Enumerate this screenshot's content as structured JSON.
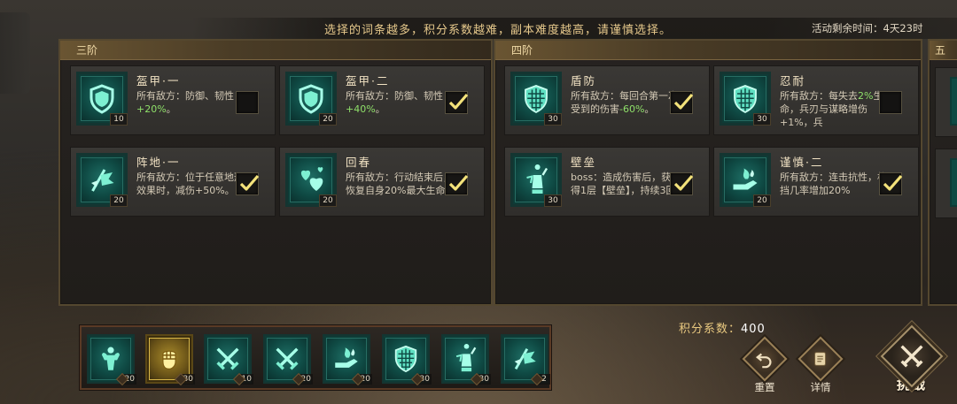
{
  "banner": {
    "message": "选择的词条越多，积分系数越难，副本难度越高，请谨慎选择。",
    "timer": "活动剩余时间：4天23时"
  },
  "tiers": [
    {
      "title": "三阶",
      "cards": [
        {
          "title": "盔甲·一",
          "desc_prefix": "所有敌方：防御、韧性",
          "desc_highlight": "+20%",
          "desc_suffix": "。",
          "level": "10",
          "checked": false,
          "icon": "shield-icon"
        },
        {
          "title": "盔甲·二",
          "desc_prefix": "所有敌方：防御、韧性",
          "desc_highlight": "+40%",
          "desc_suffix": "。",
          "level": "20",
          "checked": true,
          "icon": "shield-icon"
        },
        {
          "title": "阵地·一",
          "desc_prefix": "所有敌方：位于任意地形效果时，减伤+50%。",
          "desc_highlight": "",
          "desc_suffix": "",
          "level": "20",
          "checked": true,
          "icon": "flag-icon"
        },
        {
          "title": "回春",
          "desc_prefix": "所有敌方：行动结束后，恢复自身20%最大生命。",
          "desc_highlight": "",
          "desc_suffix": "",
          "level": "20",
          "checked": true,
          "icon": "hearts-icon"
        }
      ]
    },
    {
      "title": "四阶",
      "cards": [
        {
          "title": "盾防",
          "desc_prefix": "所有敌方：每回合第一次受到的伤害",
          "desc_highlight": "-60%",
          "desc_suffix": "。",
          "level": "30",
          "checked": true,
          "icon": "scale-shield-icon"
        },
        {
          "title": "忍耐",
          "desc_prefix": "所有敌方：每失去",
          "desc_highlight": "2%",
          "desc_suffix": "生命，兵刃与谋略增伤+1%，兵",
          "level": "30",
          "checked": false,
          "icon": "scale-shield-icon"
        },
        {
          "title": "壁垒",
          "desc_prefix": "boss：造成伤害后，获得1层【壁垒】，持续3回",
          "desc_highlight": "",
          "desc_suffix": "",
          "level": "30",
          "checked": true,
          "icon": "statue-icon"
        },
        {
          "title": "谨慎·二",
          "desc_prefix": "所有敌方：连击抗性，格挡几率增加20%",
          "desc_highlight": "",
          "desc_suffix": "",
          "level": "20",
          "checked": true,
          "icon": "hand-fire-icon"
        }
      ]
    },
    {
      "title": "五",
      "cards": []
    }
  ],
  "score": {
    "label": "积分系数：",
    "value": "400"
  },
  "selected": [
    {
      "icon": "strongman-icon",
      "level": "20"
    },
    {
      "icon": "fist-icon",
      "level": "30",
      "gold": true
    },
    {
      "icon": "crossed-swords-icon",
      "level": "10"
    },
    {
      "icon": "crossed-swords-icon",
      "level": "20"
    },
    {
      "icon": "hand-fire-icon",
      "level": "20"
    },
    {
      "icon": "scale-shield-icon",
      "level": "30"
    },
    {
      "icon": "statue-icon",
      "level": "30"
    },
    {
      "icon": "flag-icon",
      "level": "2"
    }
  ],
  "buttons": {
    "reset": "重置",
    "details": "详情",
    "challenge": "挑战"
  },
  "colors": {
    "accent": "#e7c98c",
    "highlight": "#8fe06a",
    "icon_teal": "#1e6e64"
  }
}
